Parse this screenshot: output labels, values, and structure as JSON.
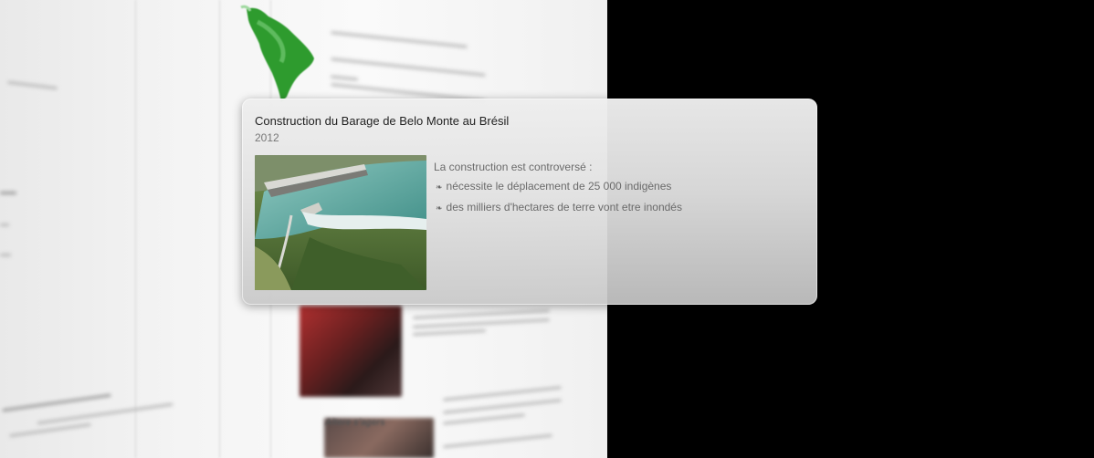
{
  "popup": {
    "title": "Construction du Barage de Belo Monte au Brésil",
    "year": "2012",
    "description": "La construction est controversé :",
    "bullets": [
      {
        "icon": "fleuron-icon",
        "text": "nécessite le déplacement de 25 000 indigènes"
      },
      {
        "icon": "fleuron-icon",
        "text": "des milliers d'hectares de terre vont etre inondés"
      }
    ],
    "bullet_glyph": "❧",
    "image": "dam-aerial-photo"
  },
  "background": {
    "map": "south-america-map",
    "section_heading": "Altere s'agers",
    "colors": {
      "page": "#f4f4f4",
      "outside": "#000000",
      "map_green": "#2e9b2e"
    }
  }
}
